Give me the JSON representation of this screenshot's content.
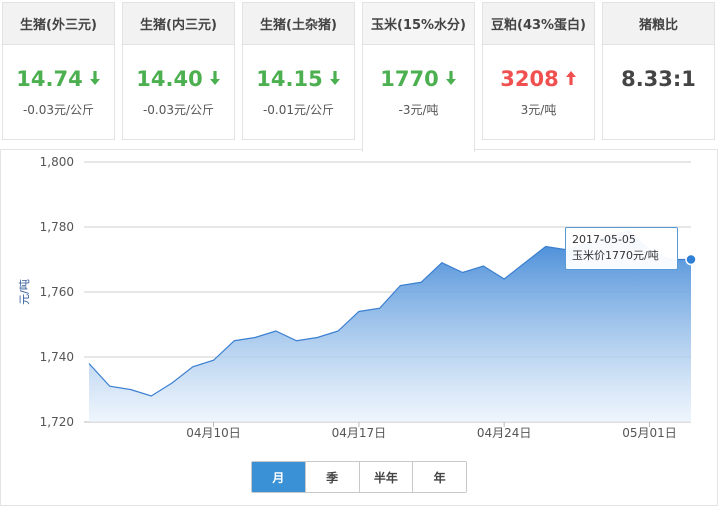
{
  "cards": [
    {
      "title": "生猪(外三元)",
      "value": "14.74",
      "direction": "down",
      "change": "-0.03元/公斤",
      "color": "#4caf50"
    },
    {
      "title": "生猪(内三元)",
      "value": "14.40",
      "direction": "down",
      "change": "-0.03元/公斤",
      "color": "#4caf50"
    },
    {
      "title": "生猪(土杂猪)",
      "value": "14.15",
      "direction": "down",
      "change": "-0.01元/公斤",
      "color": "#4caf50"
    },
    {
      "title": "玉米(15%水分)",
      "value": "1770",
      "direction": "down",
      "change": "-3元/吨",
      "color": "#4caf50",
      "active": true
    },
    {
      "title": "豆粕(43%蛋白)",
      "value": "3208",
      "direction": "up",
      "change": "3元/吨",
      "color": "#f05050"
    },
    {
      "title": "猪粮比",
      "value": "8.33:1",
      "direction": "none",
      "change": "",
      "color": "#444444"
    }
  ],
  "tooltip": {
    "date": "2017-05-05",
    "text": "玉米价1770元/吨"
  },
  "range_tabs": [
    {
      "label": "月",
      "active": true
    },
    {
      "label": "季",
      "active": false
    },
    {
      "label": "半年",
      "active": false
    },
    {
      "label": "年",
      "active": false
    }
  ],
  "colors": {
    "line": "#3a7fd0",
    "fill_top": "#3d86d6",
    "fill_bottom": "#e8f1fb",
    "up": "#f05050",
    "down": "#4caf50",
    "active_tab": "#3a91d6"
  },
  "chart_data": {
    "type": "area",
    "ylabel": "元/吨",
    "ylim": [
      1720,
      1800
    ],
    "yticks": [
      1720,
      1740,
      1760,
      1780,
      1800
    ],
    "ytick_labels": [
      "1,720",
      "1,740",
      "1,760",
      "1,780",
      "1,800"
    ],
    "xtick_labels": [
      "04月10日",
      "04月17日",
      "04月24日",
      "05月01日"
    ],
    "xtick_positions": [
      6,
      13,
      20,
      27
    ],
    "grid": true,
    "series": [
      {
        "values": [
          1738,
          1731,
          1730,
          1728,
          1732,
          1737,
          1739,
          1745,
          1746,
          1748,
          1745,
          1746,
          1748,
          1754,
          1755,
          1762,
          1763,
          1769,
          1766,
          1768,
          1764,
          1769,
          1774,
          1773,
          1775,
          1777,
          1779,
          1773,
          1770,
          1770
        ]
      }
    ],
    "highlight": {
      "date": "2017-05-05",
      "value": 1770
    }
  }
}
